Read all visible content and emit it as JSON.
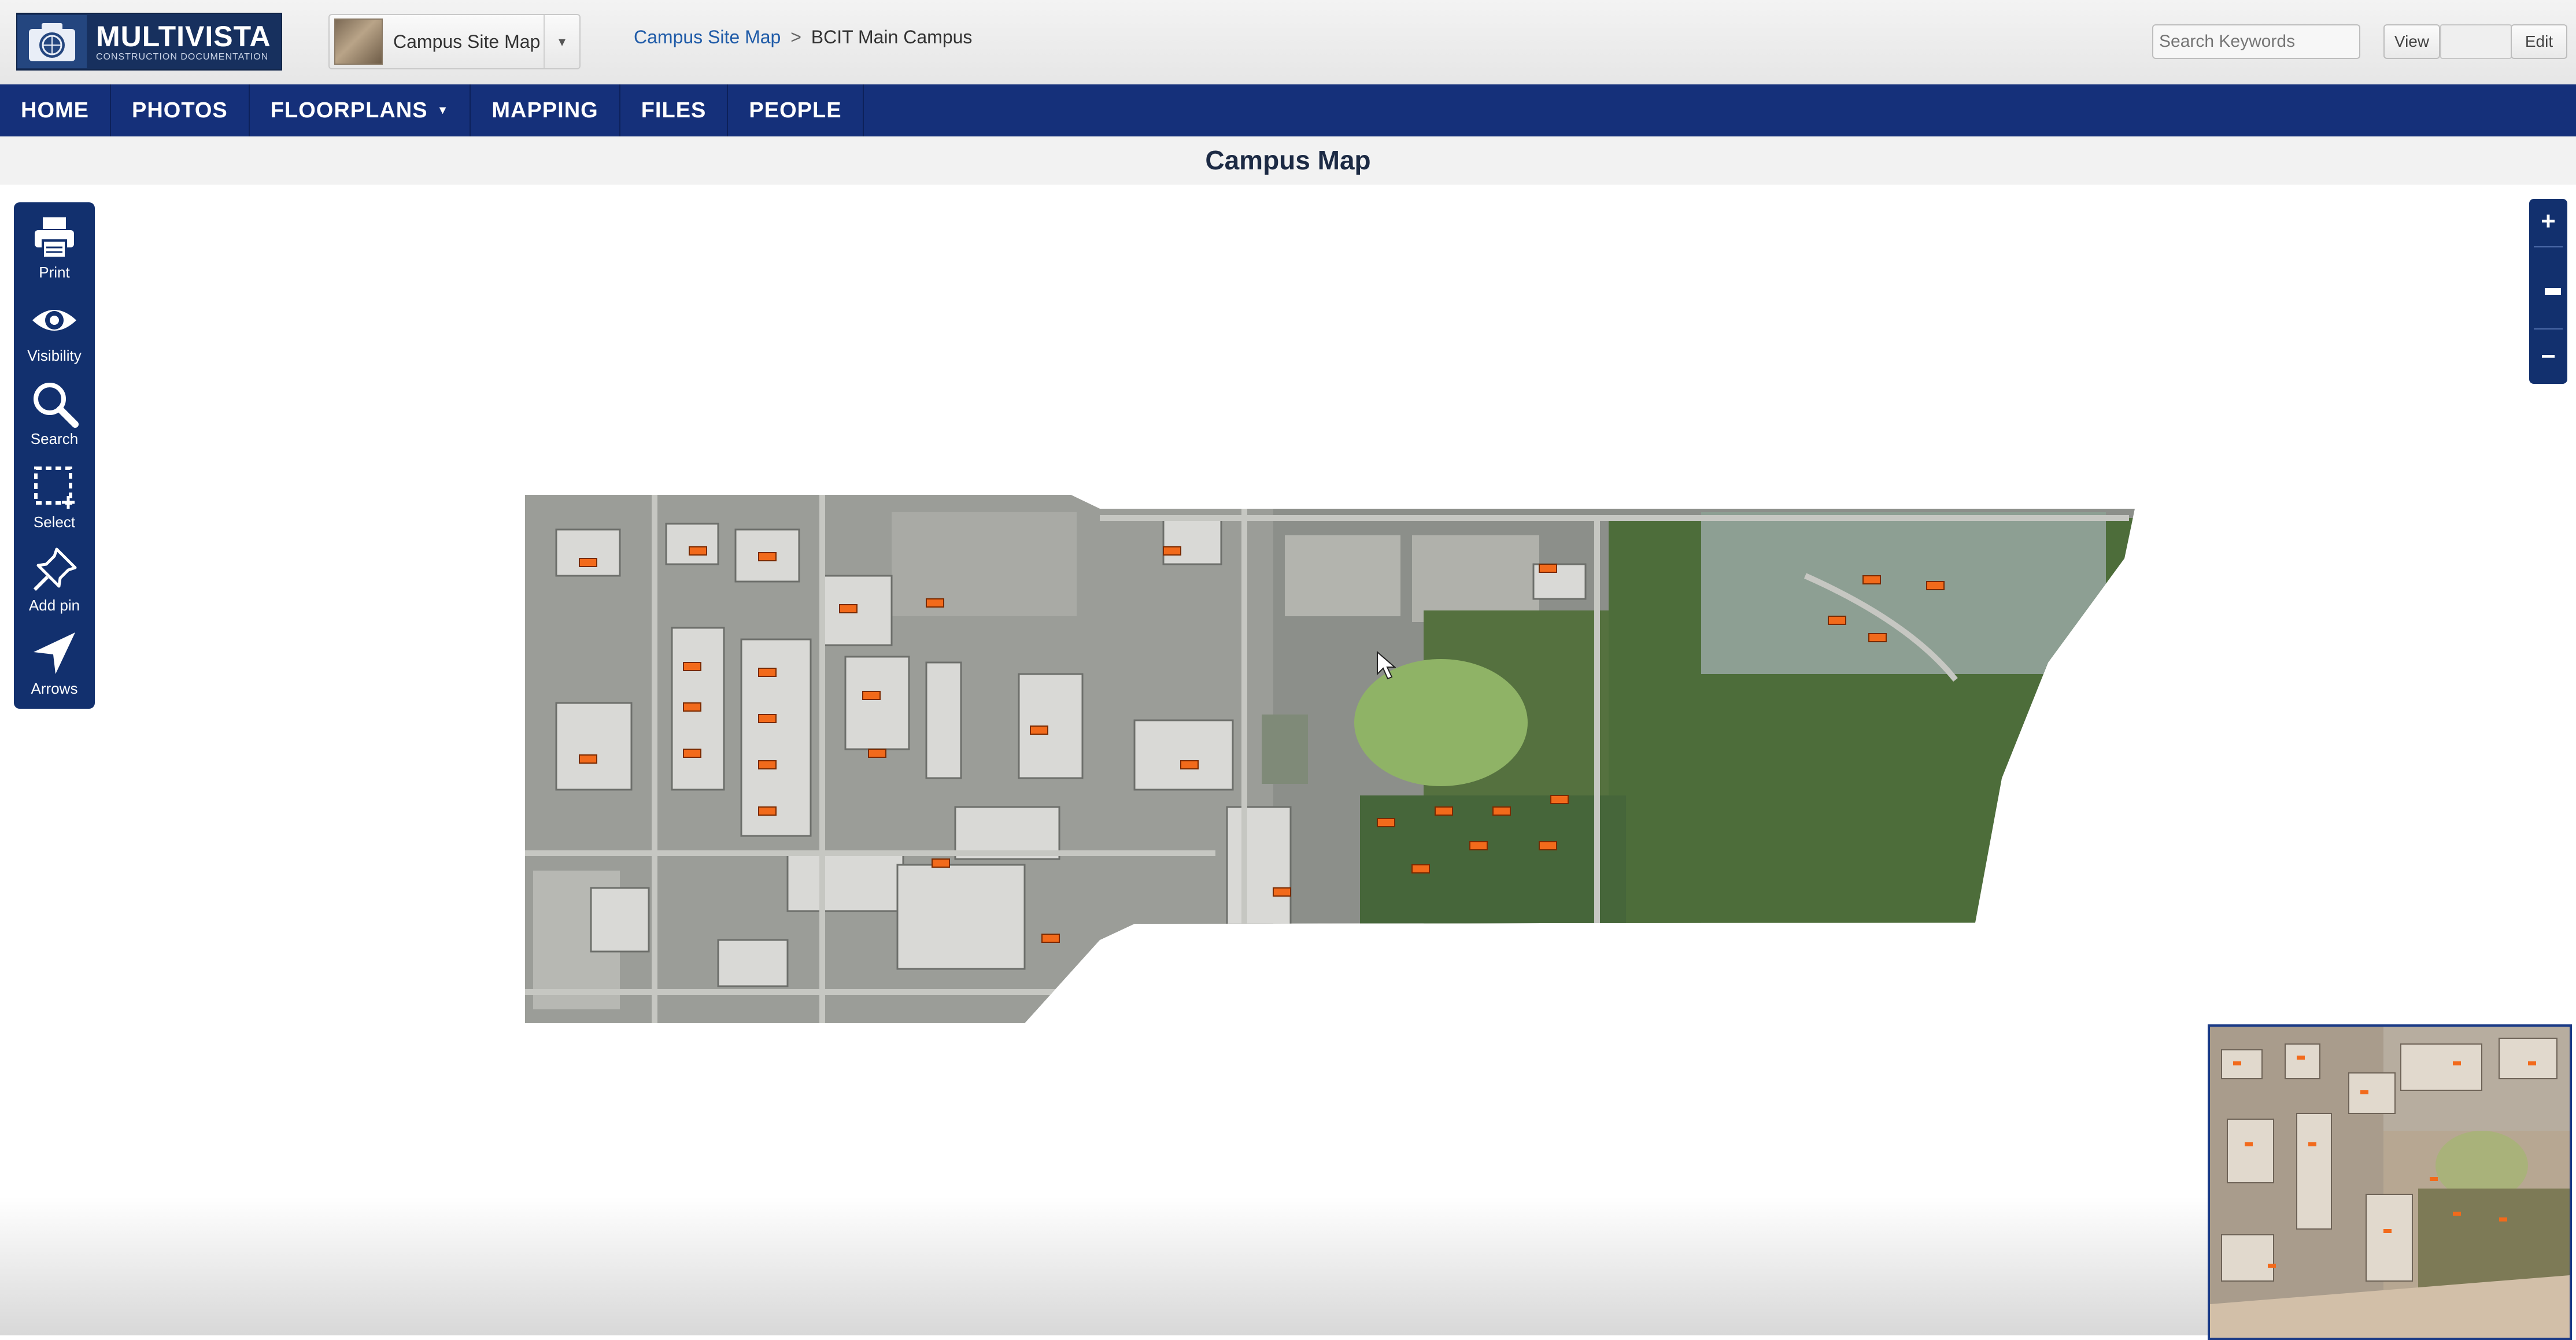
{
  "app": {
    "logo_title": "MULTIVISTA",
    "logo_subtitle": "CONSTRUCTION DOCUMENTATION"
  },
  "header": {
    "project_name": "Campus Site Map",
    "breadcrumb": {
      "link": "Campus Site Map",
      "separator": ">",
      "current": "BCIT Main Campus"
    },
    "search": {
      "placeholder": "Search Keywords"
    },
    "view_label": "View",
    "edit_label": "Edit"
  },
  "nav": {
    "items": [
      {
        "label": "HOME"
      },
      {
        "label": "PHOTOS"
      },
      {
        "label": "FLOORPLANS",
        "has_dropdown": true
      },
      {
        "label": "MAPPING"
      },
      {
        "label": "FILES"
      },
      {
        "label": "PEOPLE"
      }
    ]
  },
  "page": {
    "title": "Campus Map"
  },
  "toolbar": {
    "tools": [
      {
        "label": "Print",
        "icon": "printer-icon"
      },
      {
        "label": "Visibility",
        "icon": "eye-icon"
      },
      {
        "label": "Search",
        "icon": "magnifier-icon"
      },
      {
        "label": "Select",
        "icon": "selection-box-icon"
      },
      {
        "label": "Add pin",
        "icon": "pushpin-icon"
      },
      {
        "label": "Arrows",
        "icon": "arrow-pointer-icon"
      }
    ]
  },
  "zoom": {
    "zoom_in": "+",
    "zoom_out": "−",
    "level": 0.55
  },
  "colors": {
    "nav_bg": "#15307a",
    "toolbar_bg": "#12306e",
    "marker": "#f26a1b",
    "link": "#1f5ba8"
  }
}
